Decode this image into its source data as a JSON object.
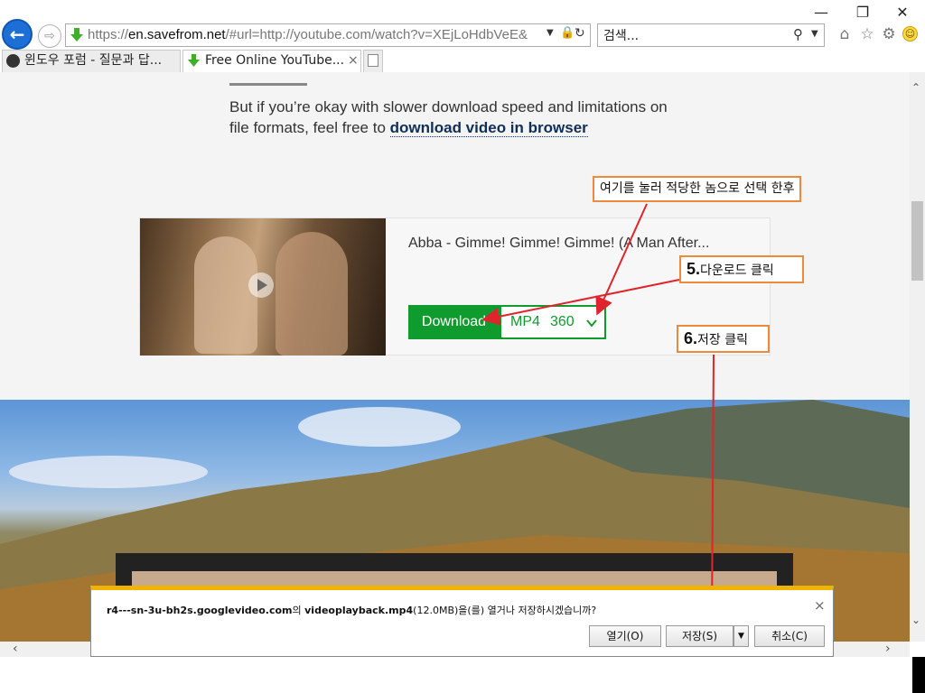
{
  "browser": {
    "address_url_prefix": "https://",
    "address_url_host": "en.savefrom.net",
    "address_url_rest": "/#url=http://youtube.com/watch?v=XEjLoHdbVeE&",
    "search_placeholder": "검색...",
    "back_glyph": "←",
    "forward_glyph": "⇨"
  },
  "tabs": [
    {
      "label": "윈도우 포럼 - 질문과 답...",
      "icon": "forum-icon"
    },
    {
      "label": "Free Online YouTube...",
      "icon": "savefrom-icon"
    }
  ],
  "page": {
    "intro_line1": "But if you’re okay with slower download speed and limitations on",
    "intro_line2_prefix": "file formats, feel free to ",
    "intro_link": "download video in browser",
    "video_title": "Abba - Gimme! Gimme! Gimme! (A Man After...",
    "download_label": "Download",
    "format": "MP4",
    "quality": "360"
  },
  "annotations": {
    "select_note": "여기를 눌러 적당한 놈으로 선택 한후",
    "step5_num": "5.",
    "step5_text": "다운로드 클릭",
    "step6_num": "6.",
    "step6_text": "저장 클릭"
  },
  "dialog": {
    "host": "r4---sn-3u-bh2s.googlevideo.com",
    "host_suffix": "의 ",
    "filename": "videoplayback.mp4",
    "message_rest": "(12.0MB)을(를) 열거나 저장하시겠습니까?",
    "open_label": "열기(O)",
    "save_label": "저장(S)",
    "cancel_label": "취소(C)",
    "close_glyph": "×"
  },
  "colors": {
    "accent_green": "#109b2e",
    "annotation_orange": "#ed8a3e",
    "arrow_red": "#e0242c",
    "dialog_bar": "#f0b400"
  }
}
